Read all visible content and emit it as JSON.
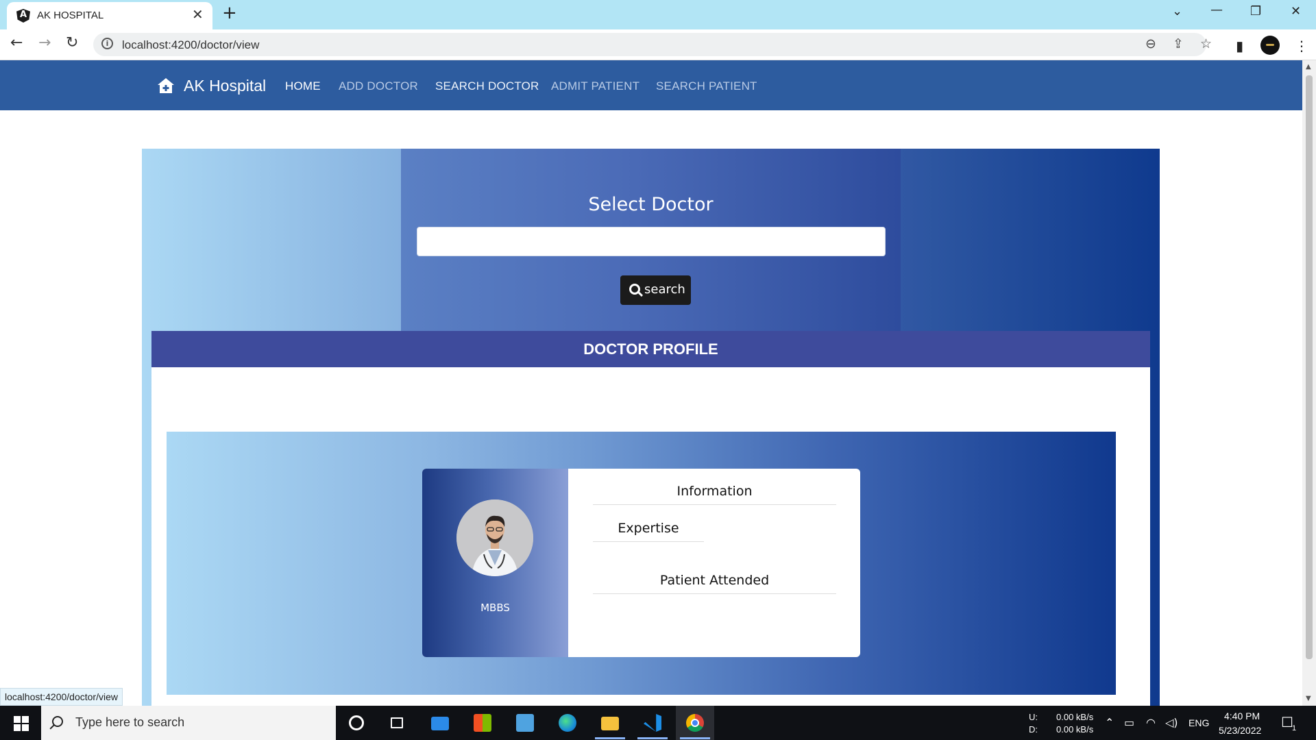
{
  "browser": {
    "tab_title": "AK HOSPITAL",
    "url": "localhost:4200/doctor/view",
    "status_url": "localhost:4200/doctor/view"
  },
  "navbar": {
    "brand": "AK Hospital",
    "items": [
      {
        "label": "HOME",
        "state": "active"
      },
      {
        "label": "ADD DOCTOR",
        "state": "muted"
      },
      {
        "label": "SEARCH DOCTOR",
        "state": "bright"
      },
      {
        "label": "ADMIT PATIENT",
        "state": "muted"
      },
      {
        "label": "SEARCH PATIENT",
        "state": "muted"
      }
    ]
  },
  "search": {
    "title": "Select Doctor",
    "input_value": "",
    "button_label": "search"
  },
  "profile": {
    "header": "DOCTOR PROFILE",
    "qualification": "MBBS",
    "information_label": "Information",
    "expertise_label": "Expertise",
    "patient_attended_label": "Patient Attended"
  },
  "taskbar": {
    "search_placeholder": "Type here to search",
    "net_up_label": "U:",
    "net_down_label": "D:",
    "net_up": "0.00 kB/s",
    "net_down": "0.00 kB/s",
    "language": "ENG",
    "time": "4:40 PM",
    "date": "5/23/2022",
    "notification_count": "1"
  },
  "colors": {
    "navbar": "#2d5c9f",
    "profile_header": "#3e4b9c",
    "search_button": "#1b1b1b"
  }
}
